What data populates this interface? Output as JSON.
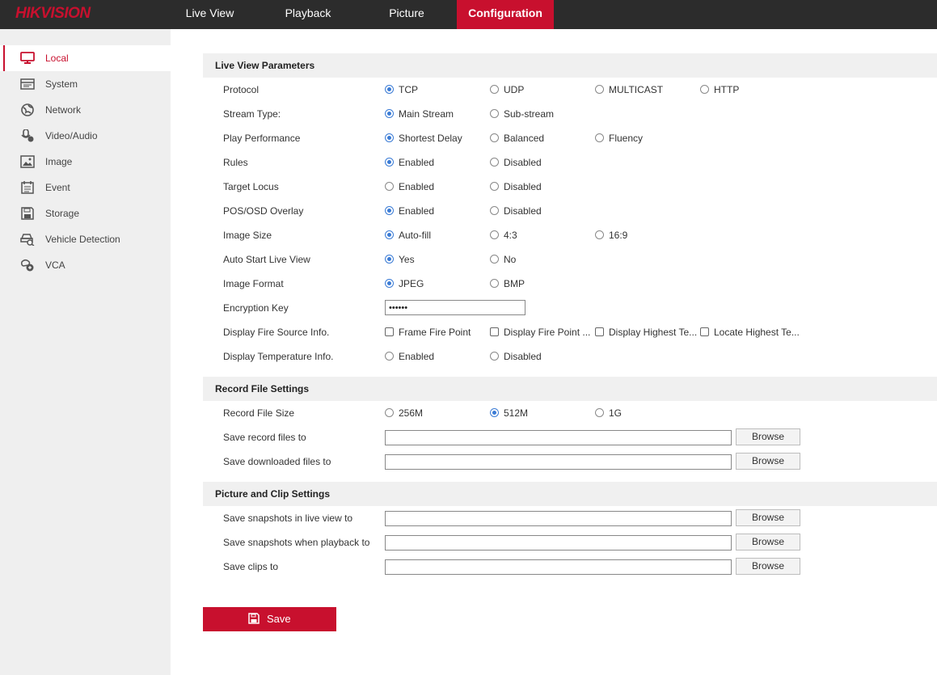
{
  "brand": "HIKVISION",
  "nav": {
    "tabs": [
      {
        "label": "Live View"
      },
      {
        "label": "Playback"
      },
      {
        "label": "Picture"
      },
      {
        "label": "Configuration"
      }
    ]
  },
  "sidebar": {
    "items": [
      {
        "label": "Local",
        "icon": "monitor-icon"
      },
      {
        "label": "System",
        "icon": "system-icon"
      },
      {
        "label": "Network",
        "icon": "globe-icon"
      },
      {
        "label": "Video/Audio",
        "icon": "microphone-icon"
      },
      {
        "label": "Image",
        "icon": "image-icon"
      },
      {
        "label": "Event",
        "icon": "calendar-icon"
      },
      {
        "label": "Storage",
        "icon": "disk-icon"
      },
      {
        "label": "Vehicle Detection",
        "icon": "vehicle-icon"
      },
      {
        "label": "VCA",
        "icon": "vca-icon"
      }
    ]
  },
  "live_view": {
    "title": "Live View Parameters",
    "protocol": {
      "label": "Protocol",
      "options": [
        "TCP",
        "UDP",
        "MULTICAST",
        "HTTP"
      ],
      "selected": "TCP"
    },
    "stream_type": {
      "label": "Stream Type:",
      "options": [
        "Main Stream",
        "Sub-stream"
      ],
      "selected": "Main Stream"
    },
    "play_performance": {
      "label": "Play Performance",
      "options": [
        "Shortest Delay",
        "Balanced",
        "Fluency"
      ],
      "selected": "Shortest Delay"
    },
    "rules": {
      "label": "Rules",
      "options": [
        "Enabled",
        "Disabled"
      ],
      "selected": "Enabled"
    },
    "target_locus": {
      "label": "Target Locus",
      "options": [
        "Enabled",
        "Disabled"
      ],
      "selected": ""
    },
    "pos_osd": {
      "label": "POS/OSD Overlay",
      "options": [
        "Enabled",
        "Disabled"
      ],
      "selected": "Enabled"
    },
    "image_size": {
      "label": "Image Size",
      "options": [
        "Auto-fill",
        "4:3",
        "16:9"
      ],
      "selected": "Auto-fill"
    },
    "auto_start": {
      "label": "Auto Start Live View",
      "options": [
        "Yes",
        "No"
      ],
      "selected": "Yes"
    },
    "image_format": {
      "label": "Image Format",
      "options": [
        "JPEG",
        "BMP"
      ],
      "selected": "JPEG"
    },
    "encryption": {
      "label": "Encryption Key",
      "value": "••••••"
    },
    "fire_source": {
      "label": "Display Fire Source Info.",
      "options": [
        "Frame Fire Point",
        "Display Fire Point ...",
        "Display Highest Te...",
        "Locate Highest Te..."
      ]
    },
    "temperature": {
      "label": "Display Temperature Info.",
      "options": [
        "Enabled",
        "Disabled"
      ],
      "selected": ""
    }
  },
  "record": {
    "title": "Record File Settings",
    "file_size": {
      "label": "Record File Size",
      "options": [
        "256M",
        "512M",
        "1G"
      ],
      "selected": "512M"
    },
    "save_record": {
      "label": "Save record files to",
      "value": ""
    },
    "save_downloaded": {
      "label": "Save downloaded files to",
      "value": ""
    }
  },
  "picture_clip": {
    "title": "Picture and Clip Settings",
    "snap_live": {
      "label": "Save snapshots in live view to",
      "value": ""
    },
    "snap_playback": {
      "label": "Save snapshots when playback to",
      "value": ""
    },
    "clips": {
      "label": "Save clips to",
      "value": ""
    }
  },
  "browse_label": "Browse",
  "save_label": "Save",
  "colors": {
    "accent": "#c8102e",
    "topbar": "#2c2c2c",
    "radio": "#3a7bd5"
  }
}
